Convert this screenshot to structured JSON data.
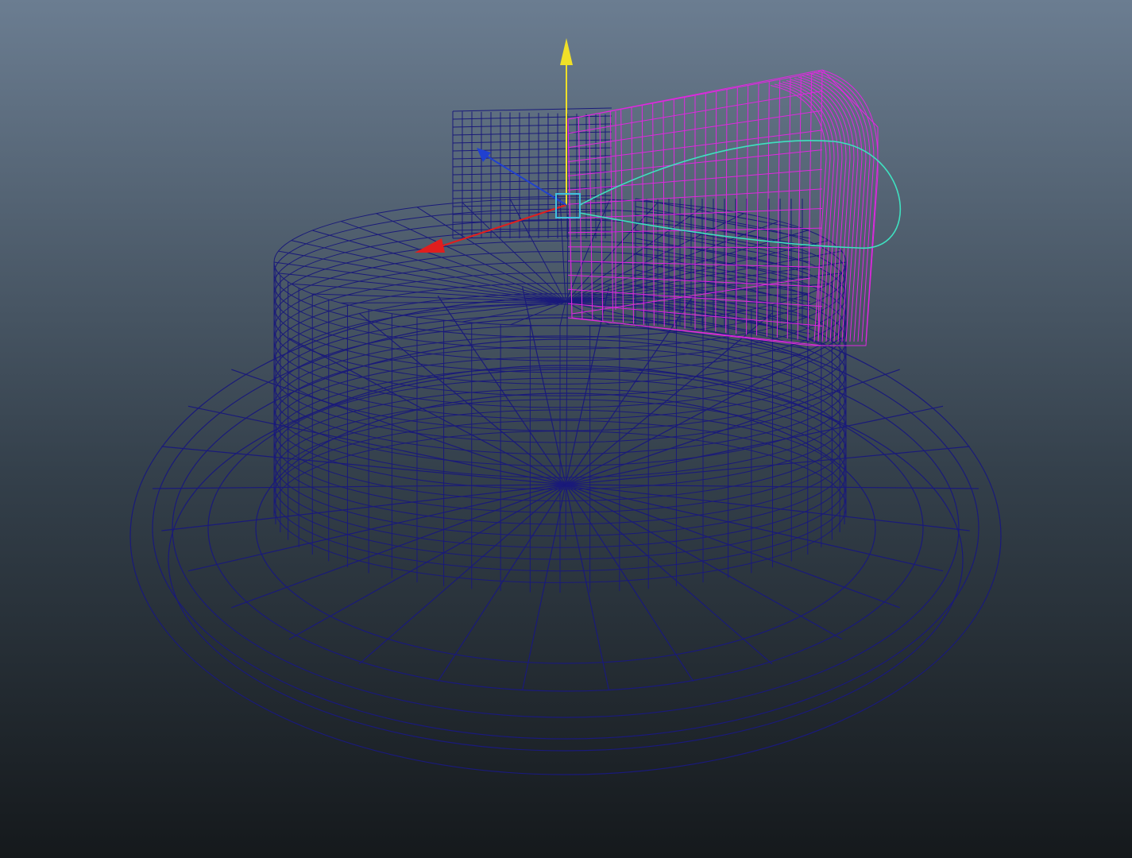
{
  "viewport": {
    "name": "3D Viewport",
    "display_mode": "wireframe",
    "background_top": "#6b7d91",
    "background_bottom": "#15191c"
  },
  "colors": {
    "wire_default": "#1a1a7a",
    "wire_selected": "#e028e0",
    "curve_highlight": "#3fe0c0",
    "axis_x": "#e01e1e",
    "axis_y": "#f0e028",
    "axis_z": "#2040d0",
    "pivot": "#40c0e0"
  },
  "objects": [
    {
      "name": "plate",
      "state": "unselected"
    },
    {
      "name": "cake-body",
      "state": "unselected"
    },
    {
      "name": "cake-slice",
      "state": "selected"
    },
    {
      "name": "motion-path-curve",
      "state": "highlighted"
    }
  ],
  "manipulator": {
    "type": "move-tool",
    "axes": [
      "x",
      "y",
      "z"
    ]
  }
}
